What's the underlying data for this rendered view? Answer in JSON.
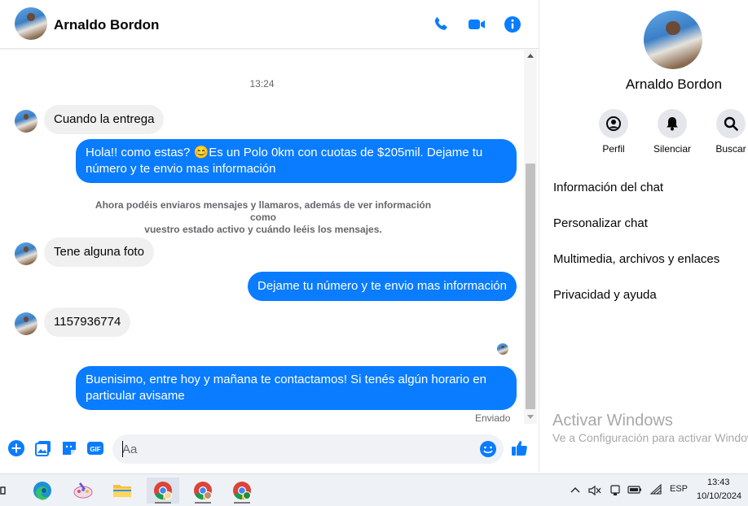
{
  "header": {
    "contact_name": "Arnaldo Bordon"
  },
  "messages": {
    "timestamp": "13:24",
    "items": [
      {
        "direction": "incoming",
        "text": "Cuando la entrega"
      },
      {
        "direction": "outgoing",
        "text_line1": "Hola!! como estas? 😊Es un Polo 0km con cuotas de $205mil. Dejame tu",
        "text_line2": "número y te envio mas información"
      },
      {
        "direction": "system",
        "text_line1": "Ahora podéis enviaros mensajes y llamaros, además de ver información como",
        "text_line2": "vuestro estado activo y cuándo leéis los mensajes."
      },
      {
        "direction": "incoming",
        "text": "Tene alguna foto"
      },
      {
        "direction": "outgoing",
        "text": "Dejame tu número y te envio mas información"
      },
      {
        "direction": "incoming",
        "text": "1157936774"
      },
      {
        "direction": "outgoing",
        "text_line1": "Buenisimo, entre hoy y mañana te contactamos! Si tenés algún horario en",
        "text_line2": "particular avisame"
      }
    ],
    "status": "Enviado"
  },
  "composer": {
    "placeholder": "Aa"
  },
  "side_panel": {
    "name": "Arnaldo Bordon",
    "actions": [
      {
        "label": "Perfil",
        "icon": "profile-icon"
      },
      {
        "label": "Silenciar",
        "icon": "bell-icon"
      },
      {
        "label": "Buscar",
        "icon": "search-icon"
      }
    ],
    "menu": [
      "Información del chat",
      "Personalizar chat",
      "Multimedia, archivos y enlaces",
      "Privacidad y ayuda"
    ],
    "watermark_title": "Activar Windows",
    "watermark_subtitle": "Ve a Configuración para activar Windows."
  },
  "taskbar": {
    "apps": [
      "task-view-icon",
      "edge-icon",
      "paint-icon",
      "file-explorer-icon",
      "chrome-icon",
      "chrome-icon",
      "chrome-icon"
    ],
    "language": "ESP",
    "time": "13:43",
    "date": "10/10/2024"
  },
  "colors": {
    "accent": "#0a7cff",
    "incoming_bubble": "#f0f0f0",
    "outgoing_bubble": "#0a7cff",
    "text_secondary": "#65676b"
  }
}
